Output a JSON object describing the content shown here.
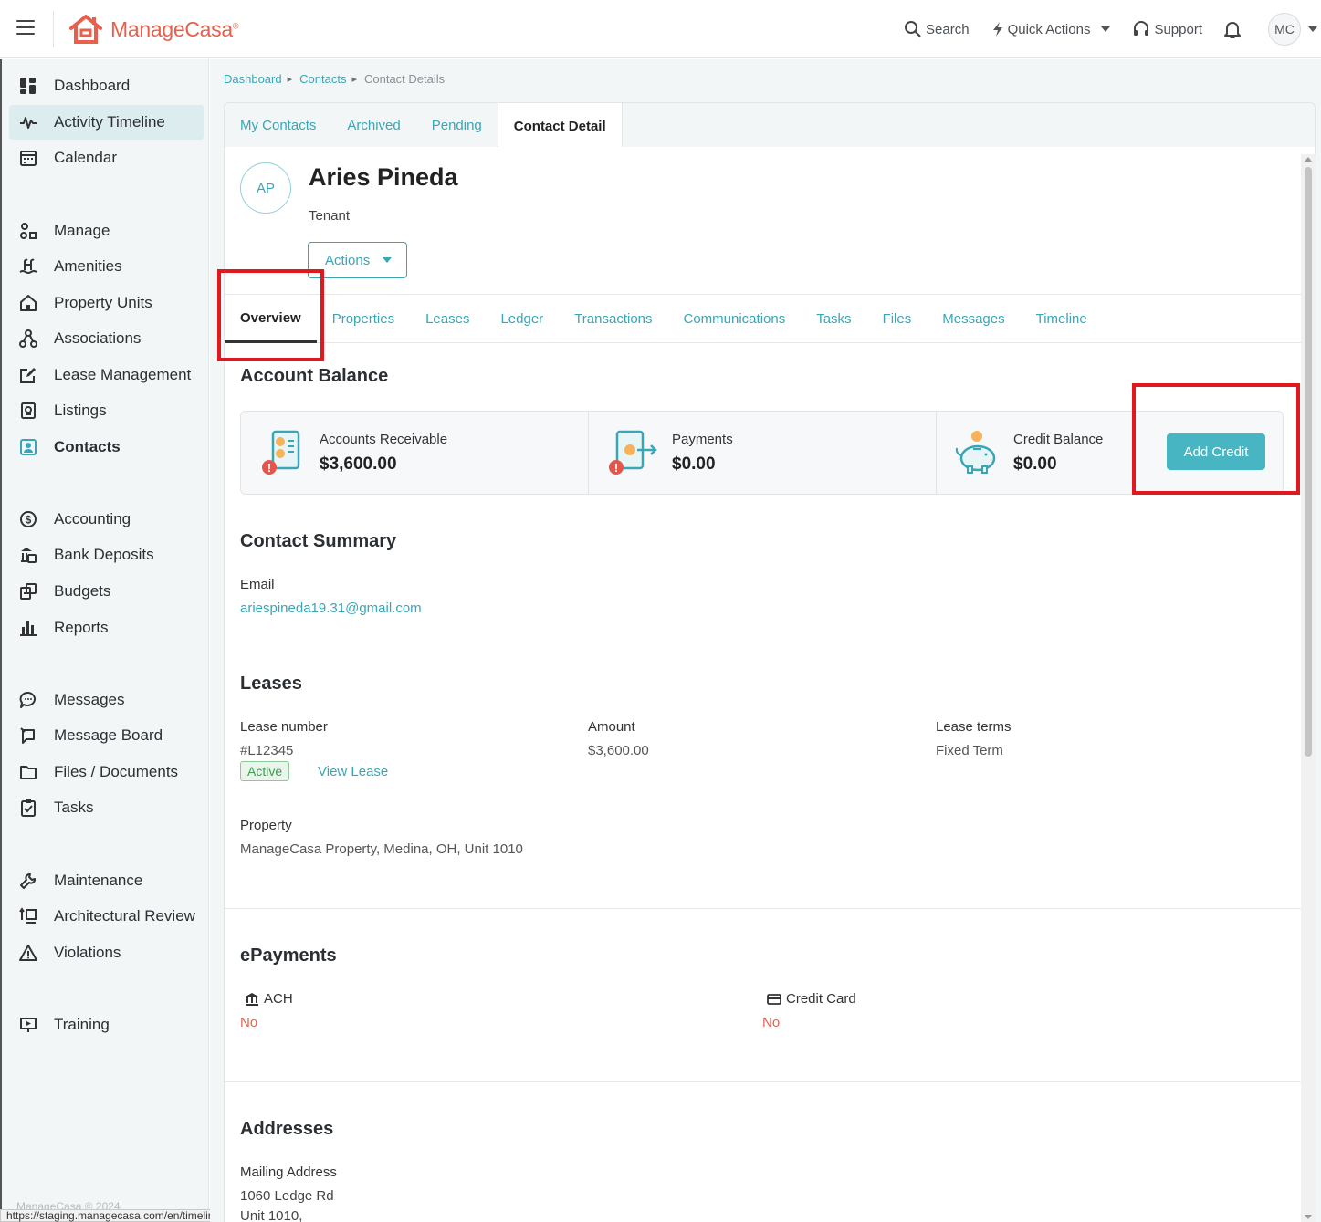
{
  "app": {
    "brand_left": "Manage",
    "brand_right": "Casa",
    "brand_mark": "®",
    "brand_color": "#e8604c",
    "accent_color": "#3aa5b6"
  },
  "topbar": {
    "search": "Search",
    "quick_actions": "Quick Actions",
    "support": "Support",
    "avatar": "MC"
  },
  "sidebar": {
    "items": [
      {
        "label": "Dashboard",
        "icon": "dashboard-icon"
      },
      {
        "label": "Activity Timeline",
        "icon": "pulse-icon"
      },
      {
        "label": "Calendar",
        "icon": "calendar-icon"
      },
      {
        "label": "Manage",
        "icon": "shapes-icon"
      },
      {
        "label": "Amenities",
        "icon": "pool-icon"
      },
      {
        "label": "Property Units",
        "icon": "home-icon"
      },
      {
        "label": "Associations",
        "icon": "network-icon"
      },
      {
        "label": "Lease Management",
        "icon": "edit-document-icon"
      },
      {
        "label": "Listings",
        "icon": "listing-icon"
      },
      {
        "label": "Contacts",
        "icon": "contact-card-icon"
      },
      {
        "label": "Accounting",
        "icon": "dollar-circle-icon"
      },
      {
        "label": "Bank Deposits",
        "icon": "bank-deposit-icon"
      },
      {
        "label": "Budgets",
        "icon": "budget-icon"
      },
      {
        "label": "Reports",
        "icon": "bar-chart-icon"
      },
      {
        "label": "Messages",
        "icon": "chat-bubble-icon"
      },
      {
        "label": "Message Board",
        "icon": "message-board-icon"
      },
      {
        "label": "Files / Documents",
        "icon": "folder-icon"
      },
      {
        "label": "Tasks",
        "icon": "clipboard-check-icon"
      },
      {
        "label": "Maintenance",
        "icon": "wrench-icon"
      },
      {
        "label": "Architectural Review",
        "icon": "review-icon"
      },
      {
        "label": "Violations",
        "icon": "warning-icon"
      },
      {
        "label": "Training",
        "icon": "presentation-icon"
      }
    ],
    "footer": "ManageCasa © 2024"
  },
  "status_url": "https://staging.managecasa.com/en/timeline",
  "breadcrumb": {
    "items": [
      "Dashboard",
      "Contacts"
    ],
    "current": "Contact Details"
  },
  "top_tabs": [
    "My Contacts",
    "Archived",
    "Pending",
    "Contact Detail"
  ],
  "contact": {
    "initials": "AP",
    "name": "Aries Pineda",
    "role": "Tenant",
    "actions_label": "Actions"
  },
  "sub_tabs": [
    "Overview",
    "Properties",
    "Leases",
    "Ledger",
    "Transactions",
    "Communications",
    "Tasks",
    "Files",
    "Messages",
    "Timeline"
  ],
  "account_balance": {
    "title": "Account Balance",
    "receivable_label": "Accounts Receivable",
    "receivable_value": "$3,600.00",
    "payments_label": "Payments",
    "payments_value": "$0.00",
    "credit_label": "Credit Balance",
    "credit_value": "$0.00",
    "add_credit": "Add Credit"
  },
  "summary": {
    "title": "Contact Summary",
    "email_label": "Email",
    "email": "ariespineda19.31@gmail.com"
  },
  "leases": {
    "title": "Leases",
    "number_label": "Lease number",
    "number": "#L12345",
    "status": "Active",
    "view_link": "View Lease",
    "amount_label": "Amount",
    "amount": "$3,600.00",
    "terms_label": "Lease terms",
    "terms": "Fixed Term",
    "property_label": "Property",
    "property": "ManageCasa Property, Medina, OH, Unit 1010"
  },
  "epayments": {
    "title": "ePayments",
    "ach_label": "ACH",
    "ach_value": "No",
    "card_label": "Credit Card",
    "card_value": "No"
  },
  "addresses": {
    "title": "Addresses",
    "mailing_label": "Mailing Address",
    "line1": "1060 Ledge Rd",
    "line2": "Unit 1010,"
  }
}
